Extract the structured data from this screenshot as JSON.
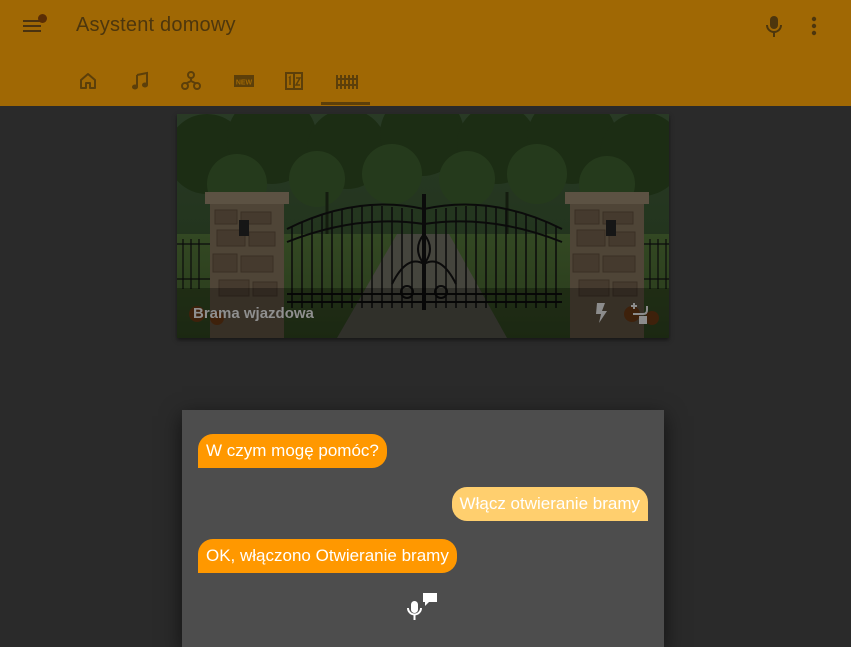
{
  "header": {
    "title": "Asystent domowy",
    "menu_icon": "menu-icon",
    "mic_icon": "microphone-icon",
    "more_icon": "dots-vertical-icon",
    "color": "#a06804"
  },
  "tabs": [
    {
      "icon": "home-icon"
    },
    {
      "icon": "music-note-icon"
    },
    {
      "icon": "network-icon"
    },
    {
      "icon": "new-box-icon"
    },
    {
      "icon": "numeric-box-icon"
    },
    {
      "icon": "gate-icon",
      "selected": true
    }
  ],
  "gate_card": {
    "label": "Brama wjazdowa",
    "action_icons": [
      "flash-icon",
      "toggle-switch-icon"
    ]
  },
  "dialog": {
    "messages": [
      {
        "from": "assistant",
        "text": "W czym mogę pomóc?"
      },
      {
        "from": "user",
        "text": "Włącz otwieranie bramy"
      },
      {
        "from": "assistant",
        "text": "OK, włączono Otwieranie bramy"
      }
    ],
    "mic_icon": "microphone-message-icon",
    "assistant_color": "#ff9800",
    "user_color": "#ffcf6e"
  }
}
